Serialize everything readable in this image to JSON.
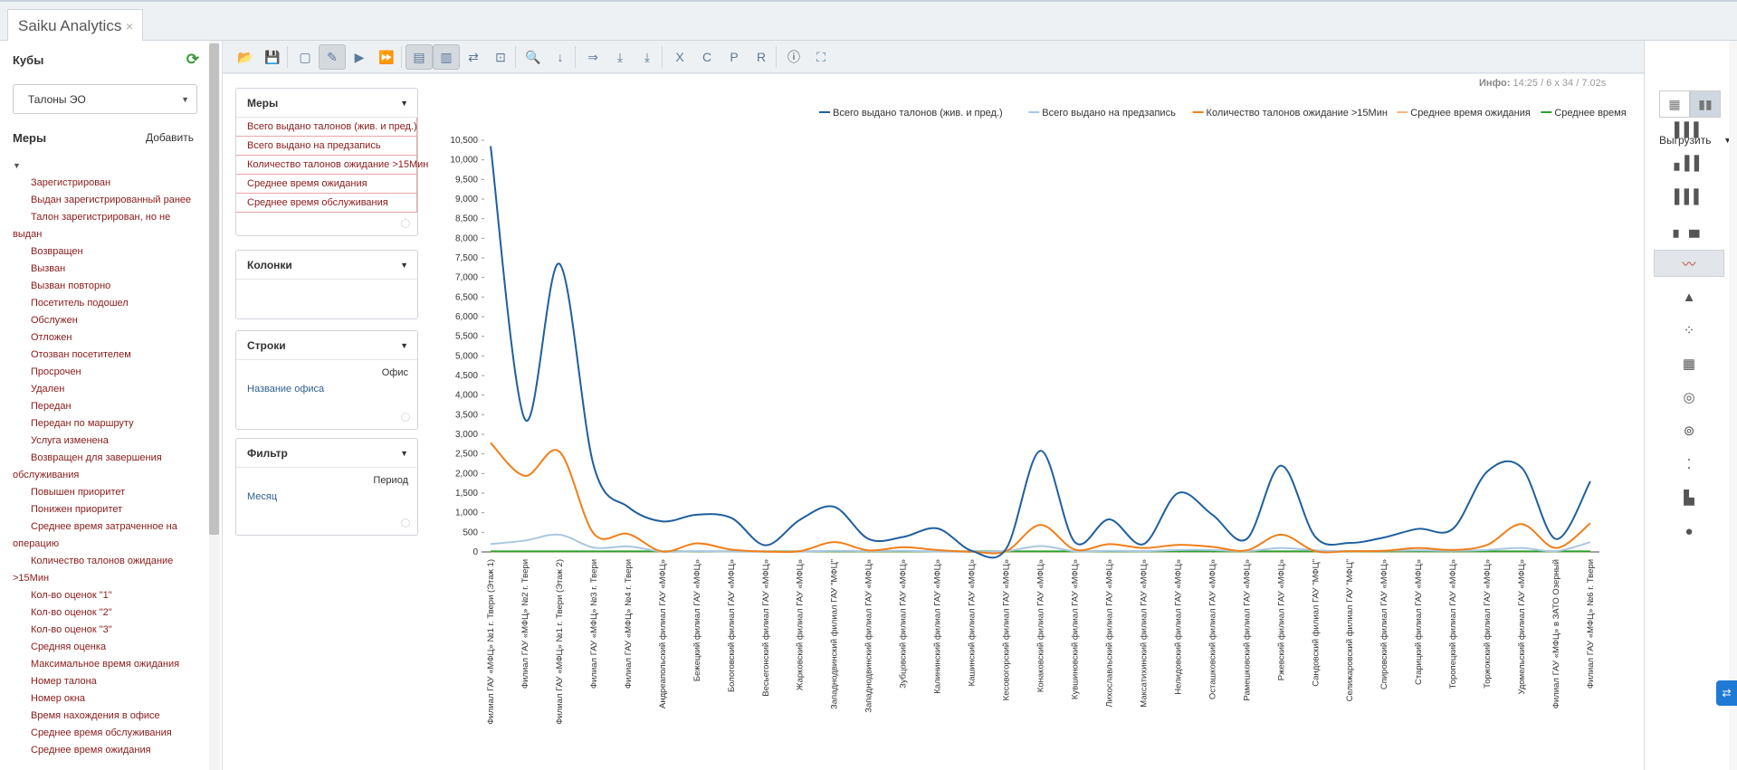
{
  "tab": {
    "title": "Saiku Analytics",
    "close": "×"
  },
  "sidebar": {
    "cubes_title": "Кубы",
    "refresh_icon": "refresh-icon",
    "cube_selected": "Талоны ЭО",
    "measures_title": "Меры",
    "add_label": "Добавить",
    "measures": [
      "Зарегистрирован",
      "Выдан зарегистрированный ранее",
      "Талон зарегистрирован, но не|выдан",
      "Возвращен",
      "Вызван",
      "Вызван повторно",
      "Посетитель подошел",
      "Обслужен",
      "Отложен",
      "Отозван посетителем",
      "Просрочен",
      "Удален",
      "Передан",
      "Передан по маршруту",
      "Услуга изменена",
      "Возвращен для завершения|обслуживания",
      "Повышен приоритет",
      "Понижен приоритет",
      "Среднее время затраченное на|операцию",
      "Количество талонов ожидание|>15Мин",
      "Кол-во оценок \"1\"",
      "Кол-во оценок \"2\"",
      "Кол-во оценок \"3\"",
      "Средняя оценка",
      "Максимальное время ожидания",
      "Номер талона",
      "Номер окна",
      "Время нахождения в офисе",
      "Среднее время обслуживания",
      "Среднее время ожидания"
    ]
  },
  "info": {
    "label": "Инфо:",
    "time": "14:25",
    "size": "6 x 34",
    "duration": "7.02s"
  },
  "panels": {
    "measures": {
      "title": "Меры",
      "items": [
        "Всего выдано талонов (жив. и пред.)",
        "Всего выдано на предзапись",
        "Количество талонов ожидание >15Мин",
        "Среднее время ожидания",
        "Среднее время обслуживания"
      ]
    },
    "columns": {
      "title": "Колонки"
    },
    "rows": {
      "title": "Строки",
      "level": "Офис",
      "value": "Название офиса"
    },
    "filter": {
      "title": "Фильтр",
      "level": "Период",
      "value": "Месяц"
    }
  },
  "right_panel": {
    "export_label": "Выгрузить"
  },
  "chart_data": {
    "type": "line",
    "ylim": [
      0,
      10500
    ],
    "yticks": [
      "0",
      "500",
      "1,000",
      "1,500",
      "2,000",
      "2,500",
      "3,000",
      "3,500",
      "4,000",
      "4,500",
      "5,000",
      "5,500",
      "6,000",
      "6,500",
      "7,000",
      "7,500",
      "8,000",
      "8,500",
      "9,000",
      "9,500",
      "10,000",
      "10,500"
    ],
    "categories": [
      "Филиал ГАУ «МФЦ» №1 г. Твери (Этаж 1)",
      "Филиал ГАУ «МФЦ» №2 г. Твери",
      "Филиал ГАУ «МФЦ» №1 г. Твери (Этаж 2)",
      "Филиал ГАУ «МФЦ» №3 г. Твери",
      "Филиал ГАУ «МФЦ» №4 г. Твери",
      "Андреапольский филиал ГАУ «МФЦ»",
      "Бежецкий филиал ГАУ «МФЦ»",
      "Бологовский филиал ГАУ «МФЦ»",
      "Весьегонский филиал ГАУ «МФЦ»",
      "Жарковский филиал ГАУ «МФЦ»",
      "Западнодвинский филиал ГАУ \"МФЦ\"",
      "Западнодвинский филиал ГАУ «МФЦ»",
      "Зубцовский филиал ГАУ «МФЦ»",
      "Калининский филиал ГАУ «МФЦ»",
      "Кашинский филиал ГАУ «МФЦ»",
      "Кесовогорский филиал ГАУ «МФЦ»",
      "Конаковский филиал ГАУ «МФЦ»",
      "Кувшиновский филиал ГАУ «МФЦ»",
      "Лихославльский филиал ГАУ «МФЦ»",
      "Максатихинский филиал ГАУ «МФЦ»",
      "Нелидовский филиал ГАУ «МФЦ»",
      "Осташковский филиал ГАУ «МФЦ»",
      "Рамешковский филиал ГАУ «МФЦ»",
      "Ржевский филиал ГАУ «МФЦ»",
      "Сандовский филиал ГАУ \"МФЦ\"",
      "Селижаровский филиал ГАУ \"МФЦ\"",
      "Спировский филиал ГАУ «МФЦ»",
      "Старицкий филиал ГАУ «МФЦ»",
      "Торопецкий филиал ГАУ «МФЦ»",
      "Торжокский филиал ГАУ «МФЦ»",
      "Удомельский филиал ГАУ «МФЦ»",
      "Филиал ГАУ «МФЦ» в ЗАТО Озерный",
      "Филиал ГАУ «МФЦ» №6 г. Твери"
    ],
    "series": [
      {
        "name": "Всего выдано талонов (жив. и пред.)",
        "color": "#1f5f9e",
        "values": [
          10350,
          3380,
          7350,
          2200,
          1150,
          780,
          950,
          870,
          170,
          820,
          1150,
          330,
          380,
          600,
          30,
          80,
          2580,
          250,
          830,
          200,
          1500,
          950,
          330,
          2200,
          380,
          230,
          370,
          590,
          590,
          2050,
          2150,
          330,
          1800
        ]
      },
      {
        "name": "Всего выдано на предзапись",
        "color": "#a9c7e3",
        "values": [
          200,
          290,
          440,
          110,
          140,
          10,
          20,
          10,
          5,
          10,
          30,
          20,
          30,
          10,
          5,
          20,
          150,
          20,
          30,
          20,
          50,
          50,
          20,
          100,
          40,
          20,
          30,
          40,
          30,
          50,
          100,
          20,
          250
        ]
      },
      {
        "name": "Количество талонов ожидание >15Мин",
        "color": "#f07f1a",
        "values": [
          2780,
          1940,
          2560,
          470,
          460,
          10,
          220,
          60,
          10,
          20,
          250,
          40,
          120,
          50,
          5,
          20,
          690,
          60,
          200,
          100,
          180,
          130,
          40,
          440,
          20,
          20,
          30,
          100,
          50,
          180,
          710,
          100,
          730
        ]
      },
      {
        "name": "Среднее время ожидания",
        "color": "#f6b77e",
        "values": [
          10,
          10,
          10,
          10,
          10,
          10,
          10,
          10,
          10,
          10,
          10,
          10,
          10,
          10,
          10,
          10,
          10,
          10,
          10,
          10,
          10,
          10,
          10,
          10,
          10,
          10,
          10,
          10,
          10,
          10,
          10,
          10,
          10
        ]
      },
      {
        "name": "Среднее время обслуживания",
        "color": "#2ca02c",
        "values": [
          15,
          15,
          15,
          15,
          15,
          15,
          15,
          15,
          15,
          15,
          15,
          15,
          15,
          15,
          15,
          15,
          15,
          15,
          15,
          15,
          15,
          15,
          15,
          15,
          15,
          15,
          15,
          15,
          15,
          15,
          15,
          15,
          15
        ]
      }
    ]
  }
}
